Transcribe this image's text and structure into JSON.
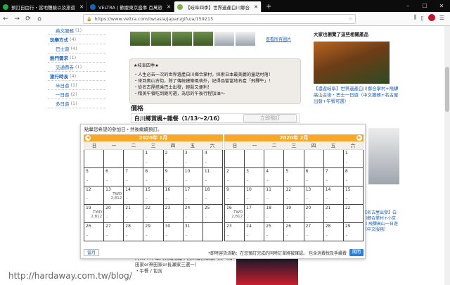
{
  "tabs": [
    {
      "title": "預訂自由行・當地體驗以及旅遊",
      "favicon_color": "#28a745",
      "active": false
    },
    {
      "title": "VELTRA | 歡慶東京盛事 百萬旅",
      "favicon_color": "#1565c0",
      "active": false
    },
    {
      "title": "【岐阜四季】世界遺產白川鄉合",
      "favicon_color": "#7cb342",
      "active": true
    }
  ],
  "window": {
    "minimize": "–",
    "maximize": "☐",
    "close": "✕",
    "newtab": "+"
  },
  "nav": {
    "back": "←",
    "forward": "→",
    "reload": "⟳",
    "home": "⌂",
    "url": "https://www.veltra.com/tw/asia/japan/gifu/a/159215",
    "menu": "☰"
  },
  "sidebar": [
    {
      "label": "英文服務",
      "count": "(1)",
      "type": "sub"
    },
    {
      "label": "玩樂方式",
      "count": "(4)",
      "type": "cat"
    },
    {
      "label": "巴士遊",
      "count": "(4)",
      "type": "sub"
    },
    {
      "label": "熱門需求",
      "count": "(1)",
      "type": "cat"
    },
    {
      "label": "交通費券",
      "count": "(1)",
      "type": "sub"
    },
    {
      "label": "旅行時長",
      "count": "(4)",
      "type": "cat"
    },
    {
      "label": "半日遊",
      "count": "(1)",
      "type": "sub"
    },
    {
      "label": "一日遊",
      "count": "(2)",
      "type": "sub"
    },
    {
      "label": "多日遊",
      "count": "(1)",
      "type": "sub"
    }
  ],
  "gallery": {
    "more_link": "查看所有圖片"
  },
  "note": {
    "heading": "★岐阜四季★",
    "lines": [
      "・人生必去一次的世界遺產白川鄉合掌村，探索日本最美麗的童話村落！",
      "・來到奧山古街，除了傳統建築風格外，記得品嘗當地名產「飛驒牛」！",
      "・從名古屋搭乘巴士出發，輕鬆又便利！",
      "・精美午餐吃到飽可選，為您的午後行程加油～"
    ]
  },
  "price": {
    "heading": "價格",
    "product": "白川鄉賞楓+雜餐（1/13～2/16）",
    "book_label": "立即預訂"
  },
  "rightcol": {
    "heading": "大家也瀏覽了這些相關產品",
    "link1": "【濃遊岐阜】世界遺產白川鄉合掌村+飛驒高山古街・巴士一日遊（中文服務+名古屋出發+午餐可選）",
    "link2": "【名古屋出發】白川鄉合掌村+小京都 飛驒高山一日遊（中文服務）"
  },
  "picker": {
    "header": "點擊您希望的參加日・然後繼續預訂。",
    "weekdays": [
      "日",
      "一",
      "二",
      "三",
      "四",
      "五",
      "六"
    ],
    "months": [
      {
        "label": "2020年 1月",
        "cells": [
          {
            "d": "",
            "dash": "",
            "p1": "",
            "p2": ""
          },
          {
            "d": "",
            "dash": "",
            "p1": "",
            "p2": ""
          },
          {
            "d": "",
            "dash": "",
            "p1": "",
            "p2": ""
          },
          {
            "d": "1",
            "dash": "-",
            "p1": "",
            "p2": ""
          },
          {
            "d": "2",
            "dash": "-",
            "p1": "",
            "p2": ""
          },
          {
            "d": "3",
            "dash": "-",
            "p1": "",
            "p2": ""
          },
          {
            "d": "4",
            "dash": "-",
            "p1": "",
            "p2": ""
          },
          {
            "d": "5",
            "dash": "-",
            "p1": "",
            "p2": ""
          },
          {
            "d": "6",
            "dash": "-",
            "p1": "",
            "p2": ""
          },
          {
            "d": "7",
            "dash": "-",
            "p1": "",
            "p2": ""
          },
          {
            "d": "8",
            "dash": "-",
            "p1": "",
            "p2": ""
          },
          {
            "d": "9",
            "dash": "-",
            "p1": "",
            "p2": ""
          },
          {
            "d": "10",
            "dash": "-",
            "p1": "",
            "p2": ""
          },
          {
            "d": "11",
            "dash": "-",
            "p1": "",
            "p2": ""
          },
          {
            "d": "12",
            "dash": "-",
            "p1": "",
            "p2": ""
          },
          {
            "d": "13",
            "dash": "",
            "p1": "TWD",
            "p2": "2,812"
          },
          {
            "d": "14",
            "dash": "-",
            "p1": "",
            "p2": ""
          },
          {
            "d": "15",
            "dash": "-",
            "p1": "",
            "p2": ""
          },
          {
            "d": "16",
            "dash": "-",
            "p1": "",
            "p2": ""
          },
          {
            "d": "17",
            "dash": "-",
            "p1": "",
            "p2": ""
          },
          {
            "d": "18",
            "dash": "-",
            "p1": "",
            "p2": ""
          },
          {
            "d": "19",
            "dash": "",
            "p1": "TWD",
            "p2": "2,812"
          },
          {
            "d": "20",
            "dash": "-",
            "p1": "",
            "p2": ""
          },
          {
            "d": "21",
            "dash": "-",
            "p1": "",
            "p2": ""
          },
          {
            "d": "22",
            "dash": "-",
            "p1": "",
            "p2": ""
          },
          {
            "d": "23",
            "dash": "-",
            "p1": "",
            "p2": ""
          },
          {
            "d": "24",
            "dash": "-",
            "p1": "",
            "p2": ""
          },
          {
            "d": "25",
            "dash": "-",
            "p1": "",
            "p2": ""
          },
          {
            "d": "26",
            "dash": "-",
            "p1": "",
            "p2": ""
          },
          {
            "d": "27",
            "dash": "-",
            "p1": "",
            "p2": ""
          },
          {
            "d": "28",
            "dash": "-",
            "p1": "",
            "p2": ""
          },
          {
            "d": "29",
            "dash": "-",
            "p1": "",
            "p2": ""
          },
          {
            "d": "30",
            "dash": "-",
            "p1": "",
            "p2": ""
          },
          {
            "d": "31",
            "dash": "-",
            "p1": "",
            "p2": ""
          },
          {
            "d": "",
            "dash": "",
            "p1": "",
            "p2": ""
          }
        ]
      },
      {
        "label": "2020年 2月",
        "cells": [
          {
            "d": "",
            "dash": "",
            "p1": "",
            "p2": ""
          },
          {
            "d": "",
            "dash": "",
            "p1": "",
            "p2": ""
          },
          {
            "d": "",
            "dash": "",
            "p1": "",
            "p2": ""
          },
          {
            "d": "",
            "dash": "",
            "p1": "",
            "p2": ""
          },
          {
            "d": "",
            "dash": "",
            "p1": "",
            "p2": ""
          },
          {
            "d": "",
            "dash": "",
            "p1": "",
            "p2": ""
          },
          {
            "d": "1",
            "dash": "-",
            "p1": "",
            "p2": ""
          },
          {
            "d": "2",
            "dash": "-",
            "p1": "",
            "p2": ""
          },
          {
            "d": "3",
            "dash": "-",
            "p1": "",
            "p2": ""
          },
          {
            "d": "4",
            "dash": "-",
            "p1": "",
            "p2": ""
          },
          {
            "d": "5",
            "dash": "-",
            "p1": "",
            "p2": ""
          },
          {
            "d": "6",
            "dash": "-",
            "p1": "",
            "p2": ""
          },
          {
            "d": "7",
            "dash": "-",
            "p1": "",
            "p2": ""
          },
          {
            "d": "8",
            "dash": "-",
            "p1": "",
            "p2": ""
          },
          {
            "d": "9",
            "dash": "-",
            "p1": "",
            "p2": ""
          },
          {
            "d": "10",
            "dash": "-",
            "p1": "",
            "p2": ""
          },
          {
            "d": "11",
            "dash": "-",
            "p1": "",
            "p2": ""
          },
          {
            "d": "12",
            "dash": "-",
            "p1": "",
            "p2": ""
          },
          {
            "d": "13",
            "dash": "-",
            "p1": "",
            "p2": ""
          },
          {
            "d": "14",
            "dash": "-",
            "p1": "",
            "p2": ""
          },
          {
            "d": "15",
            "dash": "-",
            "p1": "",
            "p2": ""
          },
          {
            "d": "16",
            "dash": "",
            "p1": "TWD",
            "p2": "2,812"
          },
          {
            "d": "17",
            "dash": "-",
            "p1": "",
            "p2": ""
          },
          {
            "d": "18",
            "dash": "-",
            "p1": "",
            "p2": ""
          },
          {
            "d": "19",
            "dash": "-",
            "p1": "",
            "p2": ""
          },
          {
            "d": "20",
            "dash": "-",
            "p1": "",
            "p2": ""
          },
          {
            "d": "21",
            "dash": "-",
            "p1": "",
            "p2": ""
          },
          {
            "d": "22",
            "dash": "-",
            "p1": "",
            "p2": ""
          },
          {
            "d": "23",
            "dash": "-",
            "p1": "",
            "p2": ""
          },
          {
            "d": "24",
            "dash": "-",
            "p1": "",
            "p2": ""
          },
          {
            "d": "25",
            "dash": "-",
            "p1": "",
            "p2": ""
          },
          {
            "d": "26",
            "dash": "-",
            "p1": "",
            "p2": ""
          },
          {
            "d": "27",
            "dash": "-",
            "p1": "",
            "p2": ""
          },
          {
            "d": "28",
            "dash": "-",
            "p1": "",
            "p2": ""
          },
          {
            "d": "29",
            "dash": "-",
            "p1": "",
            "p2": ""
          }
        ]
      }
    ],
    "prev_label": "當月",
    "footnote": "*即時容貨活動：在您預訂完成的同時訂單將被確認。  包含消費稅及手續費",
    "close_label": "關閉",
    "accent": "#f7a82a"
  },
  "bottom": {
    "text": "內Wi-Fi / 車內充電插座 / 白川鄉合掌屋門票（和田家or神田家or長瀬家三選一）",
    "text2": "・午餐 / 包含"
  },
  "watermark": "http://hardaway.com.tw/blog/"
}
